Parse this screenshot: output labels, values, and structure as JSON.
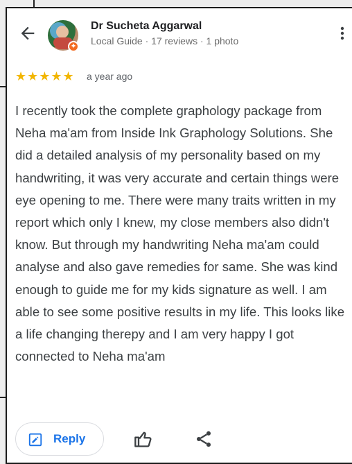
{
  "header": {
    "reviewer_name": "Dr Sucheta Aggarwal",
    "reviewer_meta": "Local Guide · 17 reviews · 1 photo",
    "icons": [
      "back-arrow-icon",
      "more-vert-icon"
    ]
  },
  "rating": {
    "stars": 5,
    "stars_text": "★★★★★",
    "age": "a year ago"
  },
  "review": {
    "text": "I recently took the complete graphology package from Neha ma'am from Inside Ink Graphology Solutions. She did a detailed analysis of my personality based on my handwriting, it was very accurate and certain things were eye opening to me. There were many traits written in my report which only I knew, my close members also didn't know. But through my handwriting Neha ma'am could analyse and also gave remedies for same. She was kind enough to guide me for my kids signature as well. I am able to see some positive results in my life. This looks like a life changing therepy and I am very happy I got connected to Neha ma'am"
  },
  "actions": {
    "reply_label": "Reply",
    "icons": [
      "reply-icon",
      "thumbs-up-icon",
      "share-icon"
    ]
  },
  "colors": {
    "star": "#f2b600",
    "reply_accent": "#1a73e8",
    "text": "#3c4043",
    "badge": "#f36b21"
  }
}
